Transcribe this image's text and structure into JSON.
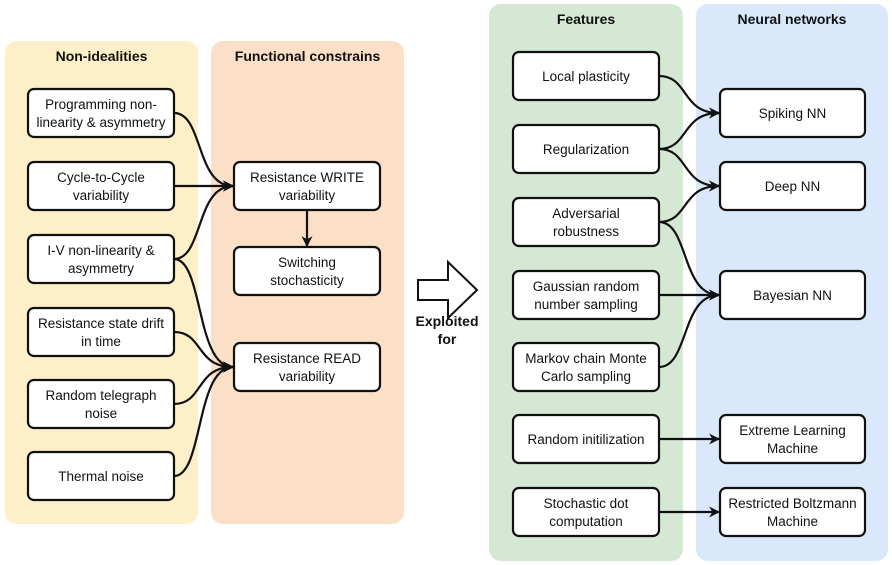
{
  "colors": {
    "non_idealities_panel": "#fdf0c9",
    "functional_panel": "#fbdfc7",
    "features_panel": "#d5e8d4",
    "neural_panel": "#dae8fc",
    "stroke": "#111111"
  },
  "panels": [
    {
      "id": "p1",
      "title": "Non-idealities"
    },
    {
      "id": "p2",
      "title": "Functional constrains"
    },
    {
      "id": "p3",
      "title": "Features"
    },
    {
      "id": "p4",
      "title": "Neural networks"
    }
  ],
  "boxes": [
    {
      "id": "prog",
      "lines": [
        "Programming non-",
        "linearity & asymmetry"
      ]
    },
    {
      "id": "c2c",
      "lines": [
        "Cycle-to-Cycle",
        "variability"
      ]
    },
    {
      "id": "iv",
      "lines": [
        "I-V non-linearity &",
        "asymmetry"
      ]
    },
    {
      "id": "drift",
      "lines": [
        "Resistance state drift",
        "in time"
      ]
    },
    {
      "id": "rtn",
      "lines": [
        "Random telegraph",
        "noise"
      ]
    },
    {
      "id": "thermal",
      "lines": [
        "Thermal noise"
      ]
    },
    {
      "id": "write",
      "lines": [
        "Resistance WRITE",
        "variability"
      ]
    },
    {
      "id": "switch",
      "lines": [
        "Switching",
        "stochasticity"
      ]
    },
    {
      "id": "read",
      "lines": [
        "Resistance READ",
        "variability"
      ]
    },
    {
      "id": "local",
      "lines": [
        "Local plasticity"
      ]
    },
    {
      "id": "reg",
      "lines": [
        "Regularization"
      ]
    },
    {
      "id": "adv",
      "lines": [
        "Adversarial",
        "robustness"
      ]
    },
    {
      "id": "gauss",
      "lines": [
        "Gaussian random",
        "number sampling"
      ]
    },
    {
      "id": "mcmc",
      "lines": [
        "Markov chain Monte",
        "Carlo sampling"
      ]
    },
    {
      "id": "rinit",
      "lines": [
        "Random initilization"
      ]
    },
    {
      "id": "sdot",
      "lines": [
        "Stochastic dot",
        "computation"
      ]
    },
    {
      "id": "snn",
      "lines": [
        "Spiking NN"
      ]
    },
    {
      "id": "dnn",
      "lines": [
        "Deep NN"
      ]
    },
    {
      "id": "bnn",
      "lines": [
        "Bayesian NN"
      ]
    },
    {
      "id": "elm",
      "lines": [
        "Extreme Learning",
        "Machine"
      ]
    },
    {
      "id": "rbm",
      "lines": [
        "Restricted Boltzmann",
        "Machine"
      ]
    }
  ],
  "edges": [
    [
      "prog",
      "write"
    ],
    [
      "c2c",
      "write"
    ],
    [
      "iv",
      "write"
    ],
    [
      "iv",
      "read"
    ],
    [
      "drift",
      "read"
    ],
    [
      "rtn",
      "read"
    ],
    [
      "thermal",
      "read"
    ],
    [
      "write",
      "switch"
    ],
    [
      "local",
      "snn"
    ],
    [
      "reg",
      "snn"
    ],
    [
      "reg",
      "dnn"
    ],
    [
      "adv",
      "dnn"
    ],
    [
      "adv",
      "bnn"
    ],
    [
      "gauss",
      "bnn"
    ],
    [
      "mcmc",
      "bnn"
    ],
    [
      "rinit",
      "elm"
    ],
    [
      "sdot",
      "rbm"
    ]
  ],
  "exploited": {
    "lines": [
      "Exploited",
      "for"
    ]
  }
}
